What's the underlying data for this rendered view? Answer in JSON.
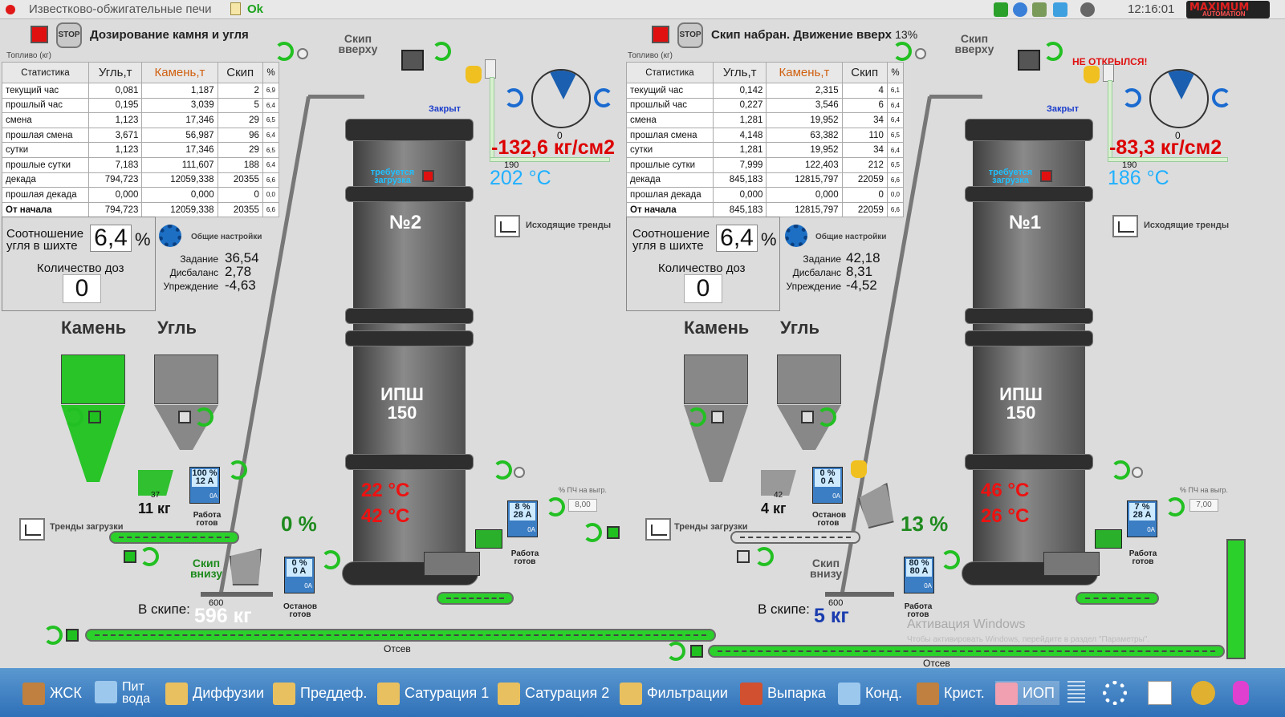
{
  "titlebar": {
    "title": "Известково-обжигательные печи",
    "status": "Ok",
    "time": "12:16:01",
    "logo_top": "MAXIMUM",
    "logo_bottom": "AUTOMATION"
  },
  "common": {
    "fuel_label": "Топливо (кг)",
    "stop_label": "STOP",
    "settings_label": "Общие настройки",
    "trends_out": "Исходящие тренды",
    "trends_load": "Тренды загрузки",
    "ratio_label": "Соотношение угля в шихте",
    "doses_label": "Количество доз",
    "set_task": "Задание",
    "set_imb": "Дисбаланс",
    "set_lead": "Упреждение",
    "stone": "Камень",
    "coal": "Угль",
    "skip_top": "Скип вверху",
    "skip_bottom": "Скип внизу",
    "in_skip": "В скипе:",
    "closed": "Закрыт",
    "need_load": "требуется загрузка",
    "ipsh": "ИПШ 150",
    "otsev": "Отсев",
    "pch": "% ПЧ на выгр.",
    "work_ready": "Работа готов",
    "stop_ready": "Останов готов",
    "pct_sym": "%",
    "unit_oa": "0A",
    "skip_scale": "600",
    "gauge_190": "190",
    "gauge_zero": "0"
  },
  "table_header": [
    "Статистика",
    "Угль,т",
    "Камень,т",
    "Скип",
    "%"
  ],
  "left": {
    "status": "Дозирование камня и угля",
    "status_pct": "",
    "rows": [
      [
        "текущий час",
        "0,081",
        "1,187",
        "2",
        "6,9"
      ],
      [
        "прошлый час",
        "0,195",
        "3,039",
        "5",
        "6,4"
      ],
      [
        "смена",
        "1,123",
        "17,346",
        "29",
        "6,5"
      ],
      [
        "прошлая смена",
        "3,671",
        "56,987",
        "96",
        "6,4"
      ],
      [
        "сутки",
        "1,123",
        "17,346",
        "29",
        "6,5"
      ],
      [
        "прошлые сутки",
        "7,183",
        "111,607",
        "188",
        "6,4"
      ],
      [
        "декада",
        "794,723",
        "12059,338",
        "20355",
        "6,6"
      ],
      [
        "прошлая декада",
        "0,000",
        "0,000",
        "0",
        "0,0"
      ],
      [
        "От начала",
        "794,723",
        "12059,338",
        "20355",
        "6,6"
      ]
    ],
    "ratio": "6,4",
    "doses": "0",
    "task": "36,54",
    "imbalance": "2,78",
    "lead": "-4,63",
    "tower": "№2",
    "pressure": "-132,6 кг/см2",
    "temp_top": "202 °C",
    "temp1": "22 °C",
    "temp2": "42 °C",
    "pct_big": "0 %",
    "kg_small": "11 кг",
    "kg_tick": "37",
    "in_skip": "596 кг",
    "pch_val": "8,00",
    "drive_coal": [
      "100 %",
      "12 A"
    ],
    "drive_skip": [
      "0 %",
      "0 A"
    ],
    "drive_fan": [
      "8 %",
      "28 A"
    ],
    "error": ""
  },
  "right": {
    "status": "Скип набран. Движение вверх",
    "status_pct": "13%",
    "rows": [
      [
        "текущий час",
        "0,142",
        "2,315",
        "4",
        "6,1"
      ],
      [
        "прошлый час",
        "0,227",
        "3,546",
        "6",
        "6,4"
      ],
      [
        "смена",
        "1,281",
        "19,952",
        "34",
        "6,4"
      ],
      [
        "прошлая смена",
        "4,148",
        "63,382",
        "110",
        "6,5"
      ],
      [
        "сутки",
        "1,281",
        "19,952",
        "34",
        "6,4"
      ],
      [
        "прошлые сутки",
        "7,999",
        "122,403",
        "212",
        "6,5"
      ],
      [
        "декада",
        "845,183",
        "12815,797",
        "22059",
        "6,6"
      ],
      [
        "прошлая декада",
        "0,000",
        "0,000",
        "0",
        "0,0"
      ],
      [
        "От начала",
        "845,183",
        "12815,797",
        "22059",
        "6,6"
      ]
    ],
    "ratio": "6,4",
    "doses": "0",
    "task": "42,18",
    "imbalance": "8,31",
    "lead": "-4,52",
    "tower": "№1",
    "pressure": "-83,3 кг/см2",
    "temp_top": "186 °C",
    "temp1": "46 °C",
    "temp2": "26 °C",
    "pct_big": "13 %",
    "kg_small": "4 кг",
    "kg_tick": "42",
    "in_skip": "5 кг",
    "pch_val": "7,00",
    "drive_coal": [
      "0 %",
      "0 A"
    ],
    "drive_skip": [
      "80 %",
      "80 A"
    ],
    "drive_fan": [
      "7 %",
      "28 A"
    ],
    "error": "НЕ ОТКРЫЛСЯ!"
  },
  "watermark": {
    "line1": "Активация Windows",
    "line2": "Чтобы активировать Windows, перейдите в раздел \"Параметры\"."
  },
  "taskbar": [
    "ЖСК",
    "Пит вода",
    "Диффузии",
    "Преддеф.",
    "Сатурация 1",
    "Сатурация 2",
    "Фильтрации",
    "Выпарка",
    "Конд.",
    "Крист.",
    "ИОП"
  ],
  "colors": {
    "accent_green": "#28c428",
    "alarm_red": "#e01010",
    "temp_cyan": "#20b0ff"
  },
  "icons": [
    "recycle-icon",
    "speaker-icon",
    "gear-icon",
    "trend-icon",
    "hand-icon",
    "stop-icon"
  ]
}
